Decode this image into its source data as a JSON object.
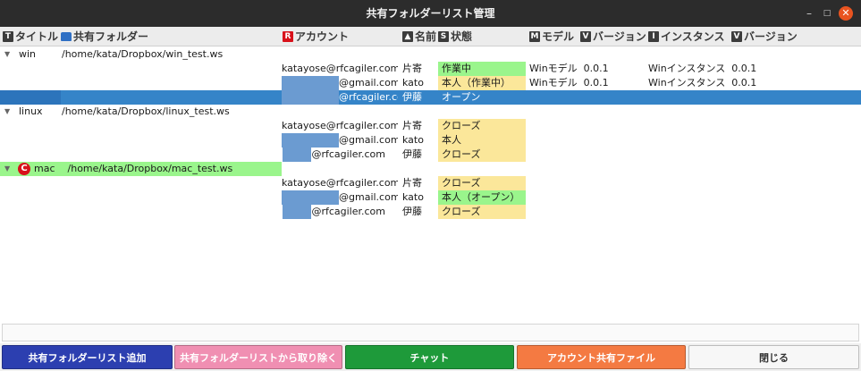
{
  "window": {
    "title": "共有フォルダーリスト管理",
    "min_glyph": "–",
    "max_glyph": "□",
    "close_glyph": "✕"
  },
  "columns": {
    "title": {
      "icon": "T",
      "label": "タイトル"
    },
    "folder": {
      "label": "共有フォルダー"
    },
    "account": {
      "icon": "R",
      "label": "アカウント"
    },
    "name": {
      "label": "名前"
    },
    "status": {
      "icon": "S",
      "label": "状態"
    },
    "model": {
      "icon": "M",
      "label": "モデル"
    },
    "model_version": {
      "icon": "V",
      "label": "バージョン"
    },
    "instance": {
      "icon": "I",
      "label": "インスタンス"
    },
    "instance_version": {
      "icon": "V",
      "label": "バージョン"
    }
  },
  "groups": [
    {
      "title": "win",
      "path": "/home/kata/Dropbox/win_test.ws",
      "members": [
        {
          "account": "katayose@rfcagiler.com",
          "name": "片寄",
          "status": "作業中",
          "model": "Winモデル",
          "model_version": "0.0.1",
          "instance": "Winインスタンス",
          "instance_version": "0.0.1"
        },
        {
          "account": "@gmail.com",
          "name": "kato",
          "status": "本人（作業中）",
          "model": "Winモデル",
          "model_version": "0.0.1",
          "instance": "Winインスタンス",
          "instance_version": "0.0.1"
        },
        {
          "account": "@rfcagiler.com",
          "name": "伊藤",
          "status": "オープン",
          "selected": true
        }
      ]
    },
    {
      "title": "linux",
      "path": "/home/kata/Dropbox/linux_test.ws",
      "members": [
        {
          "account": "katayose@rfcagiler.com",
          "name": "片寄",
          "status": "クローズ"
        },
        {
          "account": "@gmail.com",
          "name": "kato",
          "status": "本人"
        },
        {
          "account": "@rfcagiler.com",
          "name": "伊藤",
          "status": "クローズ"
        }
      ]
    },
    {
      "title": "mac",
      "icon": "C",
      "path": "/home/kata/Dropbox/mac_test.ws",
      "members": [
        {
          "account": "katayose@rfcagiler.com",
          "name": "片寄",
          "status": "クローズ"
        },
        {
          "account": "@gmail.com",
          "name": "kato",
          "status": "本人（オープン）"
        },
        {
          "account": "@rfcagiler.com",
          "name": "伊藤",
          "status": "クローズ"
        }
      ]
    }
  ],
  "buttons": {
    "add": "共有フォルダーリスト追加",
    "remove": "共有フォルダーリストから取り除く",
    "chat": "チャット",
    "account_file": "アカウント共有ファイル",
    "close": "閉じる"
  },
  "colors": {
    "titlebar": "#2c2c2c",
    "selection": "#3584c8",
    "status_green": "#9af58c",
    "status_yellow": "#fbe79a",
    "mask_blue": "#6b9bd1",
    "btn_add": "#2c3fb0",
    "btn_remove": "#f08fb2",
    "btn_chat": "#1e9a3a",
    "btn_file": "#f47a42",
    "close_circle": "#e95420"
  },
  "icons": {
    "expander": "expander-triangle-icon",
    "folder": "folder-icon",
    "mac_badge": "conflict-badge-icon"
  }
}
